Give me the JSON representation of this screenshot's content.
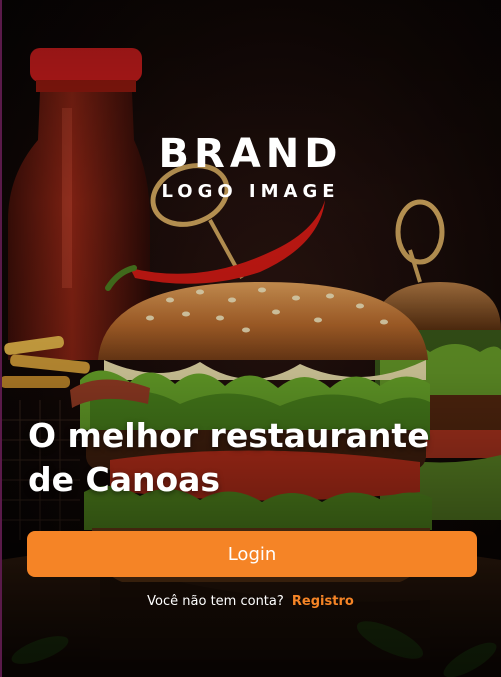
{
  "brand": {
    "title": "BRAND",
    "subtitle": "LOGO IMAGE"
  },
  "headline": {
    "line1": "O melhor restaurante",
    "line2": "de Canoas"
  },
  "login": {
    "label": "Login"
  },
  "signup": {
    "prompt": "Você não tem conta?",
    "link_label": "Registro"
  },
  "theme": {
    "accent": "#f58426",
    "text": "#ffffff",
    "background": "#0b0706"
  }
}
